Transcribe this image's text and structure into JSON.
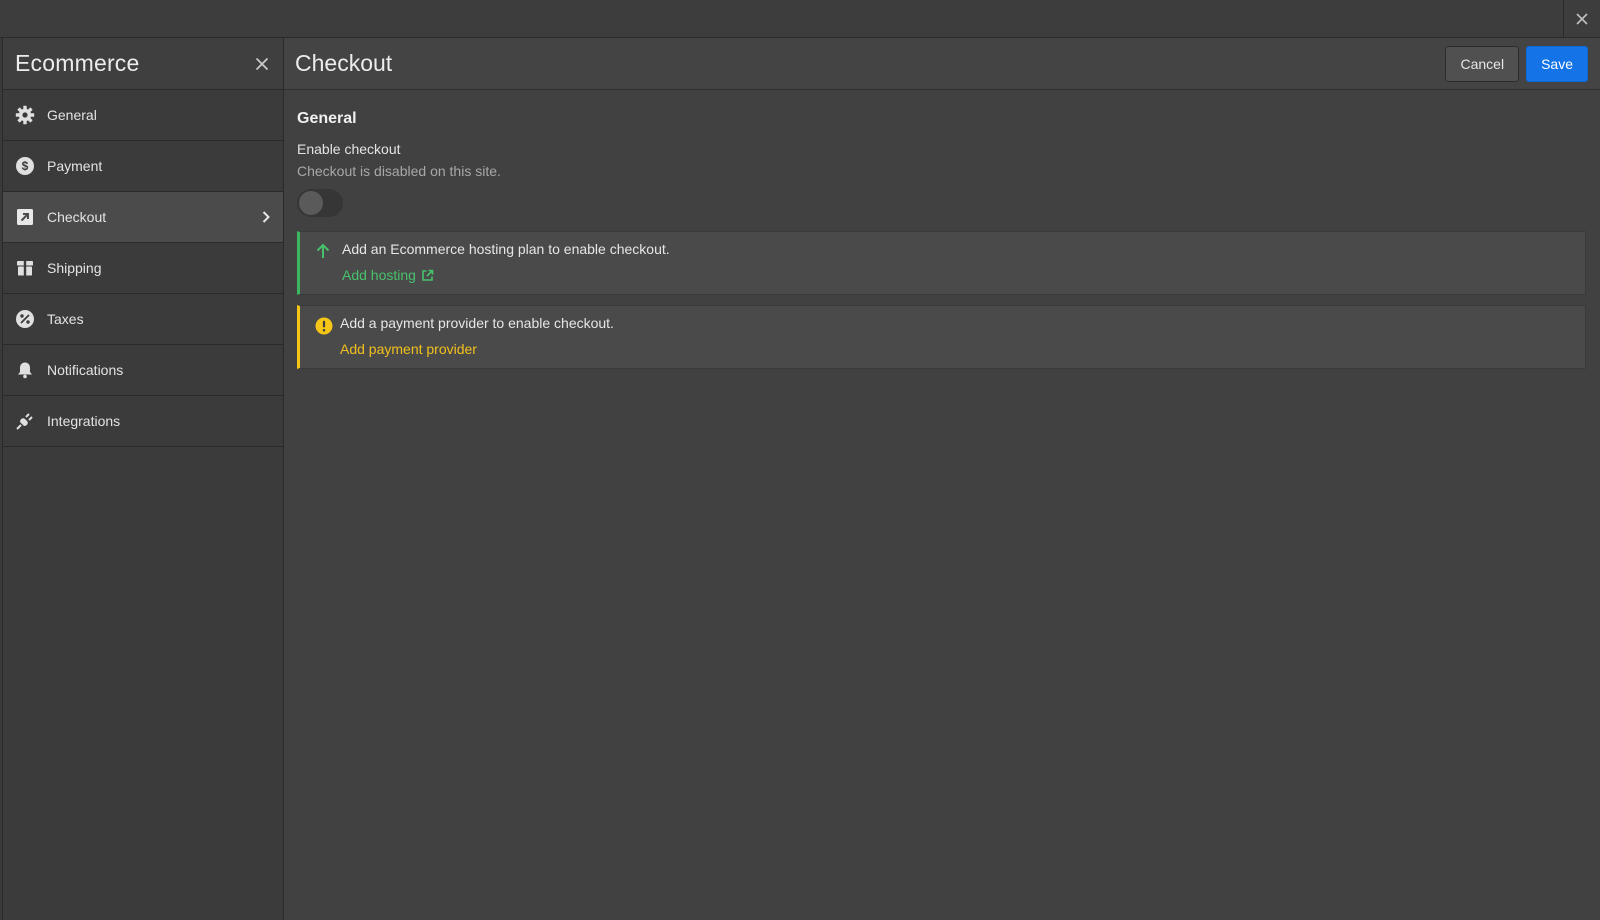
{
  "sidebar": {
    "title": "Ecommerce",
    "items": [
      {
        "label": "General",
        "icon": "gear-icon"
      },
      {
        "label": "Payment",
        "icon": "dollar-icon"
      },
      {
        "label": "Checkout",
        "icon": "checkout-arrow-icon"
      },
      {
        "label": "Shipping",
        "icon": "box-icon"
      },
      {
        "label": "Taxes",
        "icon": "percent-icon"
      },
      {
        "label": "Notifications",
        "icon": "bell-icon"
      },
      {
        "label": "Integrations",
        "icon": "plug-icon"
      }
    ],
    "active_item": "Checkout"
  },
  "main": {
    "title": "Checkout",
    "cancel_label": "Cancel",
    "save_label": "Save",
    "section_title": "General",
    "enable_label": "Enable checkout",
    "enable_desc": "Checkout is disabled on this site.",
    "toggle_on": false,
    "notices": [
      {
        "text": "Add an Ecommerce hosting plan to enable checkout.",
        "link": "Add hosting",
        "type": "success",
        "icon": "arrow-up-icon"
      },
      {
        "text": "Add a payment provider to enable checkout.",
        "link": "Add payment provider",
        "type": "warning",
        "icon": "warning-icon"
      }
    ]
  },
  "colors": {
    "accent": "#1473e6",
    "success": "#47c26c",
    "warning": "#f2c01c"
  }
}
